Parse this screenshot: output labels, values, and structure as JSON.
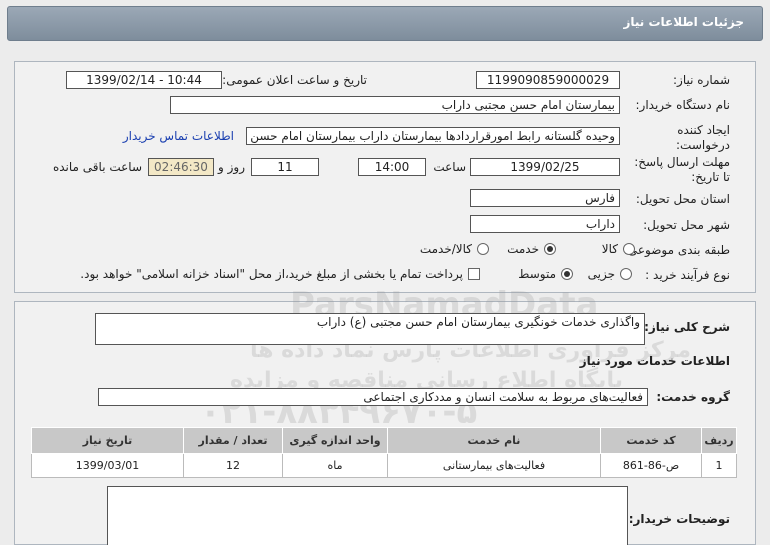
{
  "header": {
    "title": "جزئیات اطلاعات نیاز"
  },
  "info": {
    "need_number_label": "شماره نیاز:",
    "need_number": "1199090859000029",
    "announce_label": "تاریخ و ساعت اعلان عمومی:",
    "announce_value": "1399/02/14 - 10:44",
    "buyer_label": "نام دستگاه خریدار:",
    "buyer_value": "بیمارستان امام حسن مجتبی داراب",
    "requester_label": "ایجاد کننده درخواست:",
    "requester_value": "وحیده گلستانه  رابط امورقراردادها بیمارستان داراب بیمارستان امام حسن مجتبی",
    "contact_link": "اطلاعات تماس خریدار",
    "deadline_label": "مهلت ارسال پاسخ: تا تاریخ:",
    "deadline_date": "1399/02/25",
    "time_label": "ساعت",
    "deadline_time": "14:00",
    "days_value": "11",
    "days_label": "روز و",
    "remaining_time": "02:46:30",
    "remaining_label": "ساعت باقی مانده",
    "province_label": "استان محل تحویل:",
    "province_value": "فارس",
    "city_label": "شهر محل تحویل:",
    "city_value": "داراب",
    "category_label": "طبقه بندی موضوعی:",
    "category_options": [
      "کالا",
      "خدمت",
      "کالا/خدمت"
    ],
    "category_selected": "خدمت",
    "process_label": "نوع فرآیند خرید :",
    "process_options": [
      "جزیی",
      "متوسط"
    ],
    "process_selected": "متوسط",
    "payment_note": "پرداخت تمام یا بخشی از مبلغ خرید،از محل \"اسناد خزانه اسلامی\" خواهد بود."
  },
  "details": {
    "summary_label": "شرح کلی نیاز:",
    "summary_value": "واگذاری خدمات خونگیری بیمارستان امام حسن مجتبی (ع) داراب",
    "services_heading": "اطلاعات خدمات مورد نیاز",
    "service_group_label": "گروه خدمت:",
    "service_group_value": "فعالیت‌های مربوط به سلامت انسان و مددکاری اجتماعی",
    "table": {
      "headers": [
        "ردیف",
        "کد خدمت",
        "نام خدمت",
        "واحد اندازه گیری",
        "تعداد / مقدار",
        "تاریخ نیاز"
      ],
      "rows": [
        [
          "1",
          "ص-86-861",
          "فعالیت‌های بیمارستانی",
          "ماه",
          "12",
          "1399/03/01"
        ]
      ]
    },
    "buyer_notes_label": "توضیحات خریدار:",
    "buyer_notes_value": ""
  },
  "watermark": {
    "line1": "ParsNamadData",
    "line2": "مرکز فراوری اطلاعات پارس نماد داده ها",
    "line3": "پایگاه اطلاع رسانی مناقصه و مزایده",
    "line4": "۰۲۱-۸۸۳۴۹۶۷۰-۵"
  }
}
